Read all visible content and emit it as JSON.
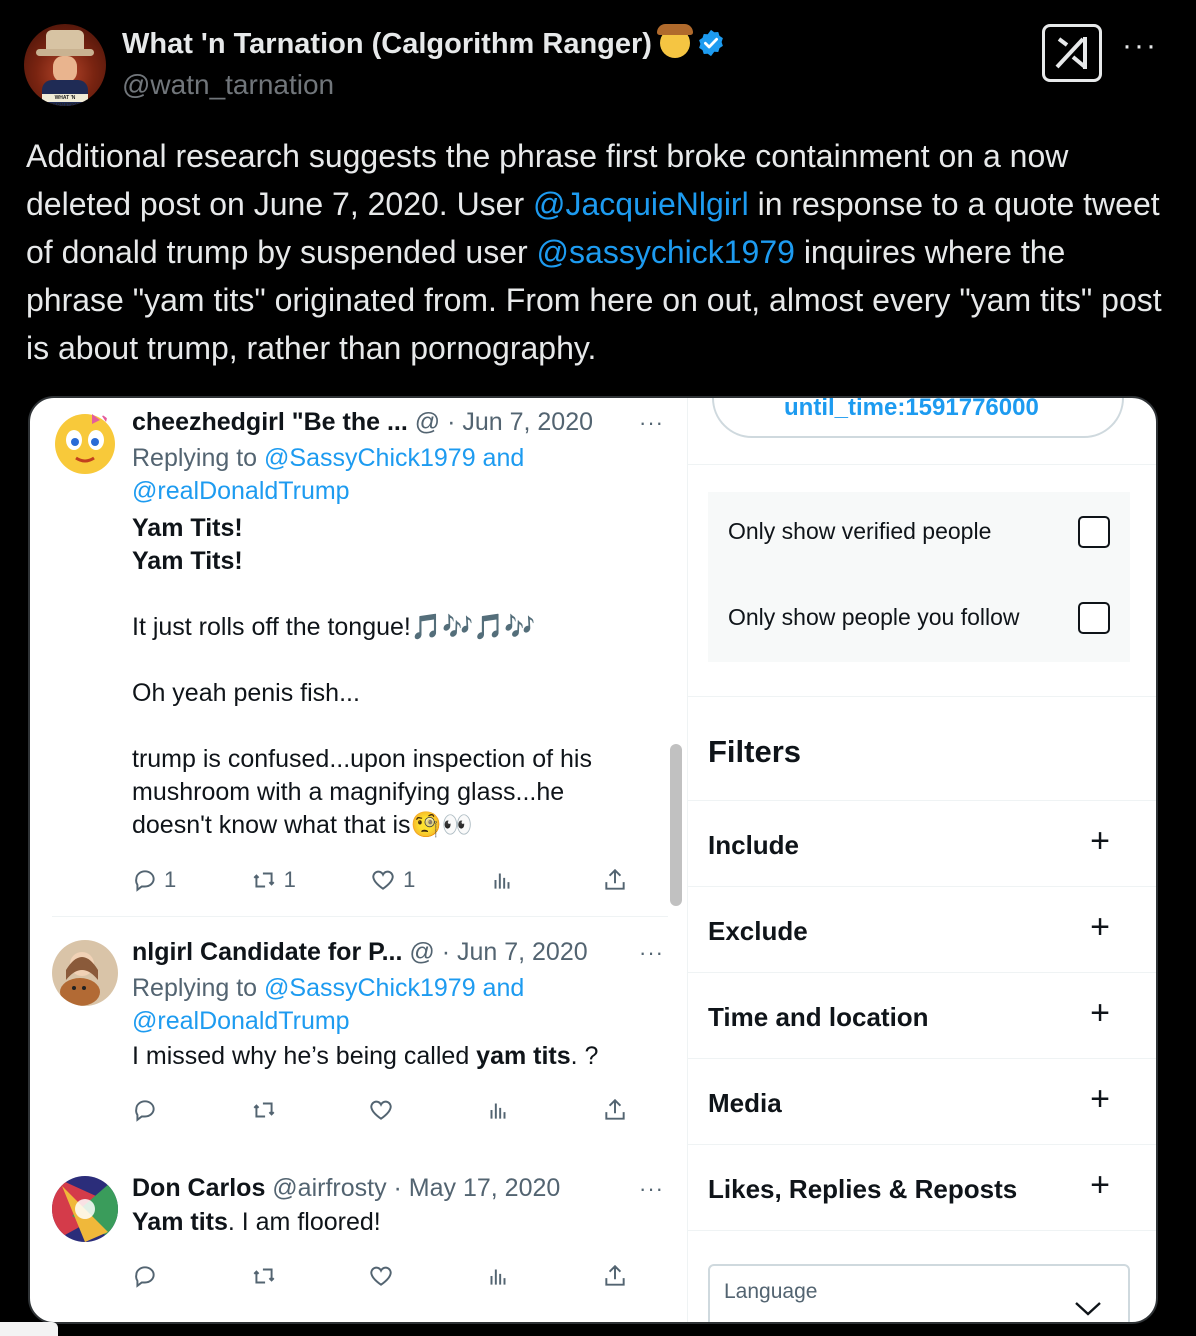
{
  "post": {
    "display_name": "What 'n Tarnation (Calgorithm Ranger)",
    "handle": "@watn_tarnation",
    "avatar_banner": "WHAT 'N TARNATION",
    "text_1": "Additional research suggests the phrase first broke containment on a now deleted post on June 7, 2020. User ",
    "mention_1": "@JacquieNlgirl",
    "text_2": " in response to a quote tweet of donald trump by suspended user ",
    "mention_2": "@sassychick1979",
    "text_3": " inquires where the phrase \"yam tits\" originated from. From here on out, almost every \"yam tits\" post is about trump, rather than pornography.",
    "icons": {
      "cowboy": "cowboy-face-icon",
      "verified": "verified-badge-icon",
      "grok": "grok-icon",
      "more": "more-icon"
    }
  },
  "feed": {
    "tweets": [
      {
        "name": "cheezhedgirl \"Be the ...",
        "meta": " @ · Jun 7, 2020",
        "replying_prefix": "Replying to ",
        "replying_to": "@SassyChick1979 and",
        "replying_to_2": "@realDonaldTrump",
        "line_1": "Yam Tits!",
        "line_2": "Yam Tits!",
        "line_3": "It just rolls off the tongue!",
        "line_3_emoji": "🎵🎶🎵🎶",
        "line_4": "Oh yeah penis fish...",
        "line_5": "trump is confused...upon inspection of his",
        "line_6": "mushroom with a magnifying glass...he",
        "line_7": "doesn't know what that is",
        "line_7_emoji": "🧐👀",
        "replies": "1",
        "reposts": "1",
        "likes": "1"
      },
      {
        "name": "nlgirl Candidate for P...",
        "meta": " @ · Jun 7, 2020",
        "replying_prefix": "Replying to ",
        "replying_to": "@SassyChick1979 and",
        "replying_to_2": "@realDonaldTrump",
        "line_1_pre": "I missed why he’s being called ",
        "line_1_bold": "yam tits",
        "line_1_post": ". ?"
      },
      {
        "name": "Don Carlos",
        "meta": " @airfrosty · May 17, 2020",
        "line_1_bold": "Yam tits",
        "line_1_post": ". I am floored!"
      }
    ]
  },
  "filters": {
    "query_text": "until_time:1591776000",
    "verified_label": "Only show verified people",
    "follow_label": "Only show people you follow",
    "title": "Filters",
    "rows": [
      "Include",
      "Exclude",
      "Time and location",
      "Media",
      "Likes, Replies & Reposts"
    ],
    "language_label": "Language"
  },
  "colors": {
    "link": "#1d9bf0",
    "background": "#000000",
    "text": "#e7e9ea",
    "muted": "#71767b"
  }
}
